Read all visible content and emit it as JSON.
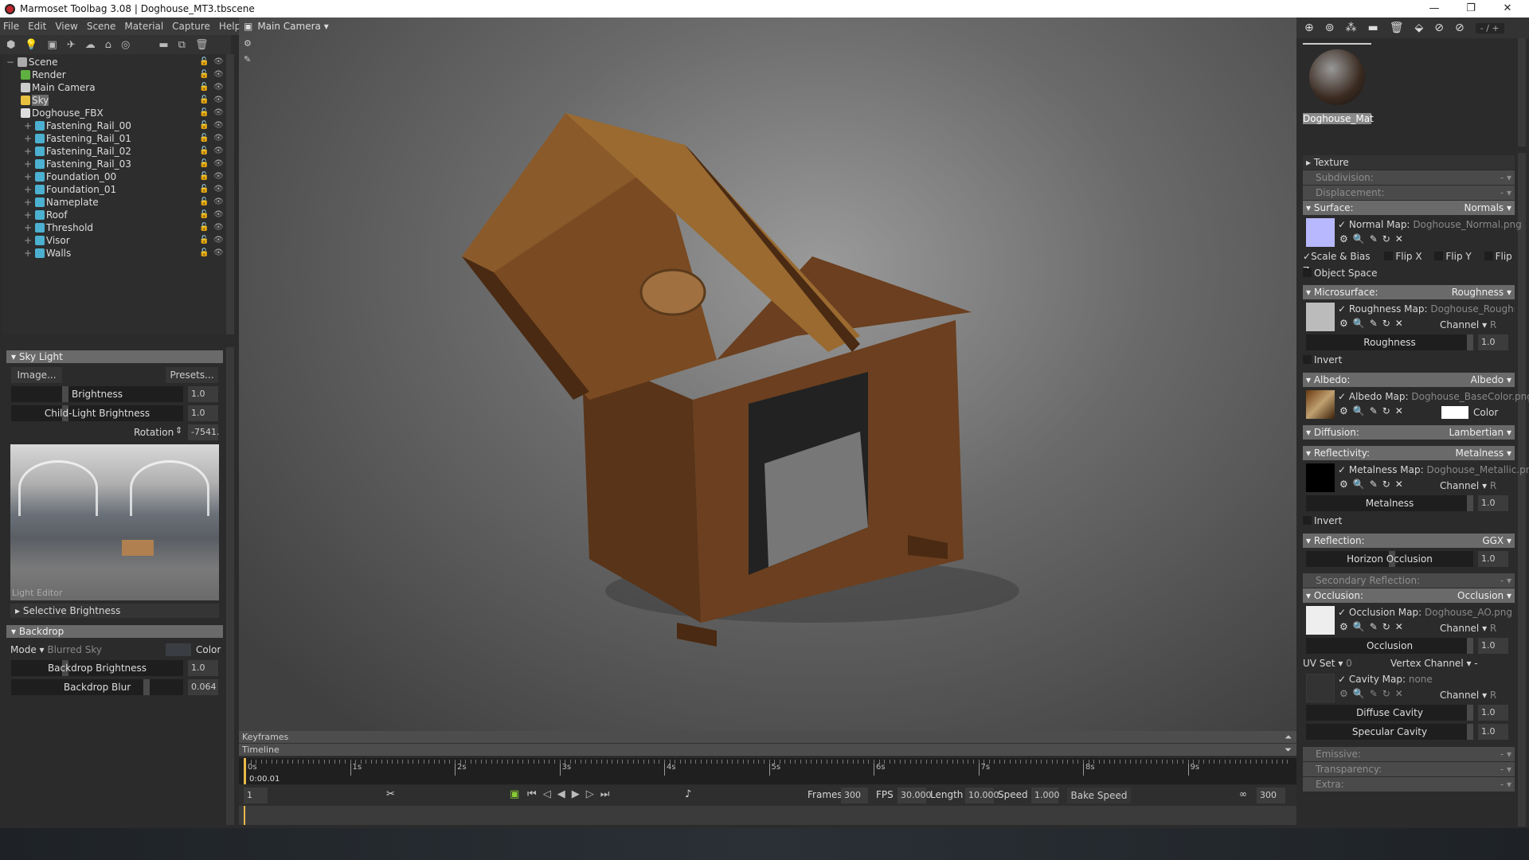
{
  "window": {
    "title": "Marmoset Toolbag 3.08  |  Doghouse_MT3.tbscene",
    "minimize": "—",
    "restore": "❐",
    "close": "✕"
  },
  "menu": [
    "File",
    "Edit",
    "View",
    "Scene",
    "Material",
    "Capture",
    "Help"
  ],
  "scene_tree": [
    {
      "label": "Scene",
      "depth": 0,
      "icon": "scene-icon",
      "color": "#aaaaaa"
    },
    {
      "label": "Render",
      "depth": 1,
      "icon": "render-gear-icon",
      "color": "#5fb040"
    },
    {
      "label": "Main Camera",
      "depth": 1,
      "icon": "camera-icon",
      "color": "#cccccc"
    },
    {
      "label": "Sky",
      "depth": 1,
      "icon": "sky-icon",
      "color": "#e8c040",
      "selected": true
    },
    {
      "label": "Doghouse_FBX",
      "depth": 1,
      "icon": "fbx-icon",
      "color": "#dddddd"
    },
    {
      "label": "Fastening_Rail_00",
      "depth": 2,
      "icon": "mesh-icon",
      "color": "#4cb0d0"
    },
    {
      "label": "Fastening_Rail_01",
      "depth": 2,
      "icon": "mesh-icon",
      "color": "#4cb0d0"
    },
    {
      "label": "Fastening_Rail_02",
      "depth": 2,
      "icon": "mesh-icon",
      "color": "#4cb0d0"
    },
    {
      "label": "Fastening_Rail_03",
      "depth": 2,
      "icon": "mesh-icon",
      "color": "#4cb0d0"
    },
    {
      "label": "Foundation_00",
      "depth": 2,
      "icon": "mesh-icon",
      "color": "#4cb0d0"
    },
    {
      "label": "Foundation_01",
      "depth": 2,
      "icon": "mesh-icon",
      "color": "#4cb0d0"
    },
    {
      "label": "Nameplate",
      "depth": 2,
      "icon": "mesh-icon",
      "color": "#4cb0d0"
    },
    {
      "label": "Roof",
      "depth": 2,
      "icon": "mesh-icon",
      "color": "#4cb0d0"
    },
    {
      "label": "Threshold",
      "depth": 2,
      "icon": "mesh-icon",
      "color": "#4cb0d0"
    },
    {
      "label": "Visor",
      "depth": 2,
      "icon": "mesh-icon",
      "color": "#4cb0d0"
    },
    {
      "label": "Walls",
      "depth": 2,
      "icon": "mesh-icon",
      "color": "#4cb0d0"
    }
  ],
  "sky_light": {
    "title": "Sky Light",
    "image_btn": "Image...",
    "presets_btn": "Presets...",
    "brightness_label": "Brightness",
    "brightness": "1.0",
    "child_label": "Child-Light Brightness",
    "child": "1.0",
    "rotation_label": "Rotation",
    "rotation": "-7541.",
    "light_editor": "Light Editor",
    "selective": "Selective Brightness"
  },
  "backdrop": {
    "title": "Backdrop",
    "mode_label": "Mode",
    "mode": "Blurred Sky",
    "color_label": "Color",
    "brightness_label": "Backdrop Brightness",
    "brightness": "1.0",
    "blur_label": "Backdrop Blur",
    "blur": "0.064"
  },
  "viewport": {
    "camera": "Main Camera"
  },
  "timeline": {
    "keyframes": "Keyframes",
    "timeline": "Timeline",
    "ticks": [
      "0s",
      "1s",
      "2s",
      "3s",
      "4s",
      "5s",
      "6s",
      "7s",
      "8s",
      "9s"
    ],
    "current_time": "0:00.01",
    "frame": "1",
    "frames_label": "Frames",
    "frames": "300",
    "fps_label": "FPS",
    "fps": "30.000",
    "length_label": "Length",
    "length": "10.000",
    "speed_label": "Speed",
    "speed": "1.000",
    "bake_speed": "Bake Speed",
    "end_frame": "300"
  },
  "material": {
    "name": "Doghouse_Mat",
    "page": "- / +",
    "texture": "Texture",
    "subdivision": "Subdivision:",
    "displacement": "Displacement:",
    "dash": "-",
    "surface": "Surface:",
    "surface_val": "Normals",
    "normal_map_label": "Normal Map:",
    "normal_map": "Doghouse_Normal.png",
    "scale_bias": "Scale & Bias",
    "flip_x": "Flip X",
    "flip_y": "Flip Y",
    "flip_z": "Flip Z",
    "object_space": "Object Space",
    "microsurface": "Microsurface:",
    "micro_val": "Roughness",
    "rough_map_label": "Roughness Map:",
    "rough_map": "Doghouse_Roughness.png",
    "channel": "Channel",
    "channel_val": "R",
    "roughness_label": "Roughness",
    "roughness": "1.0",
    "invert": "Invert",
    "albedo": "Albedo:",
    "albedo_val": "Albedo",
    "albedo_map_label": "Albedo Map:",
    "albedo_map": "Doghouse_BaseColor.png",
    "color": "Color",
    "diffusion": "Diffusion:",
    "diffusion_val": "Lambertian",
    "reflectivity": "Reflectivity:",
    "reflectivity_val": "Metalness",
    "metal_map_label": "Metalness Map:",
    "metal_map": "Doghouse_Metallic.png",
    "metalness_label": "Metalness",
    "metalness": "1.0",
    "reflection": "Reflection:",
    "reflection_val": "GGX",
    "horizon_label": "Horizon Occlusion",
    "horizon": "1.0",
    "secondary": "Secondary Reflection:",
    "occlusion": "Occlusion:",
    "occlusion_val": "Occlusion",
    "ao_map_label": "Occlusion Map:",
    "ao_map": "Doghouse_AO.png",
    "occlusion_label": "Occlusion",
    "occlusion_num": "1.0",
    "uv_set": "UV Set",
    "uv_val": "0",
    "vertex_channel": "Vertex Channel",
    "vertex_val": "-",
    "cavity_map_label": "Cavity Map:",
    "cavity_map": "none",
    "diffuse_cavity": "Diffuse Cavity",
    "diffuse_cavity_val": "1.0",
    "specular_cavity": "Specular Cavity",
    "specular_cavity_val": "1.0",
    "emissive": "Emissive:",
    "transparency": "Transparency:",
    "extra": "Extra:"
  },
  "colors": {
    "accent": "#e8b84a",
    "normal_swatch": "#b8b8ff",
    "albedo_color": "#ffffff"
  }
}
